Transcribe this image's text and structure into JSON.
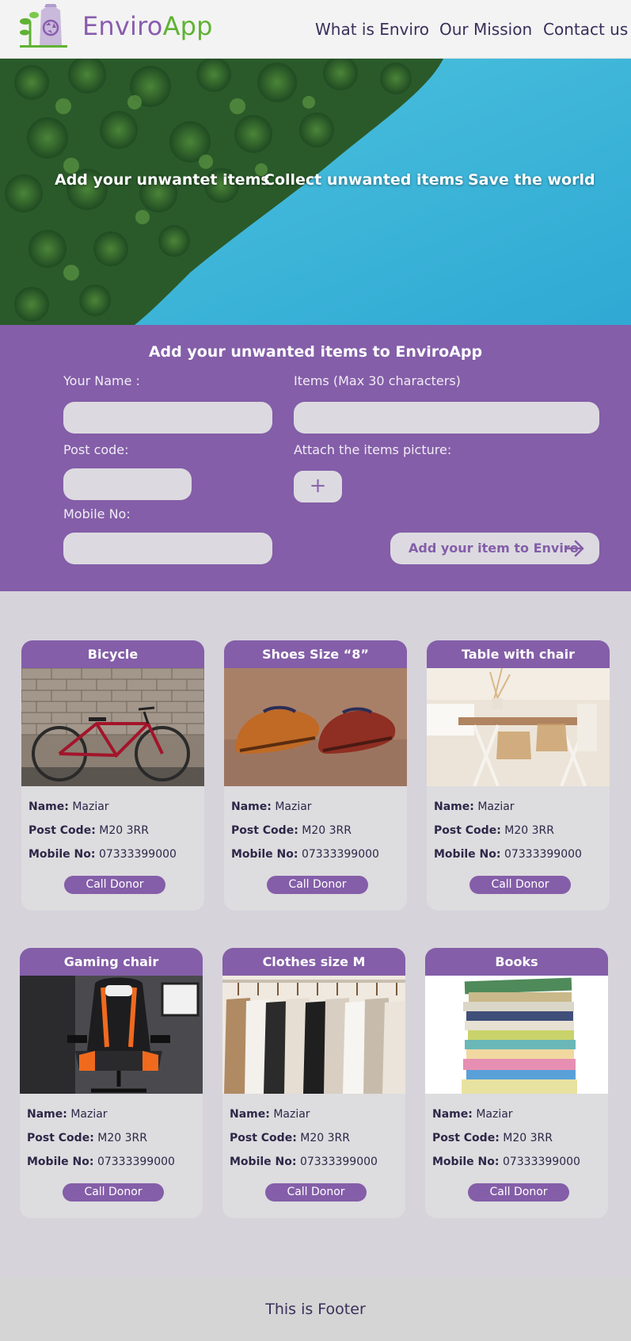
{
  "header": {
    "brand_part1": "Enviro",
    "brand_part2": "App",
    "nav": [
      "What is Enviro",
      "Our Mission",
      "Contact us"
    ]
  },
  "hero": {
    "steps": [
      "Add your unwantet items",
      "Collect unwanted items",
      "Save the world"
    ]
  },
  "form": {
    "title": "Add your unwanted items to EnviroApp",
    "name_label": "Your Name :",
    "items_label": "Items (Max 30 characters)",
    "postcode_label": "Post code:",
    "attach_label": "Attach the items picture:",
    "attach_glyph": "+",
    "mobile_label": "Mobile No:",
    "submit_label": "Add your item to Enviro",
    "name_value": "",
    "items_value": "",
    "postcode_value": "",
    "mobile_value": ""
  },
  "card_labels": {
    "name": "Name:",
    "postcode": "Post Code:",
    "mobile": "Mobile No:",
    "button": "Call Donor"
  },
  "cards": [
    {
      "title": "Bicycle",
      "name": "Maziar",
      "postcode": "M20 3RR",
      "mobile": "07333399000"
    },
    {
      "title": "Shoes Size “8”",
      "name": "Maziar",
      "postcode": "M20 3RR",
      "mobile": "07333399000"
    },
    {
      "title": "Table with chair",
      "name": "Maziar",
      "postcode": "M20 3RR",
      "mobile": "07333399000"
    },
    {
      "title": "Gaming chair",
      "name": "Maziar",
      "postcode": "M20 3RR",
      "mobile": "07333399000"
    },
    {
      "title": "Clothes size M",
      "name": "Maziar",
      "postcode": "M20 3RR",
      "mobile": "07333399000"
    },
    {
      "title": "Books",
      "name": "Maziar",
      "postcode": "M20 3RR",
      "mobile": "07333399000"
    }
  ],
  "footer": {
    "text": "This is Footer"
  },
  "colors": {
    "accent": "#845ea8",
    "brand_green": "#5fb233",
    "input_bg": "#dcdae0",
    "page_bg": "#d6d3db"
  }
}
